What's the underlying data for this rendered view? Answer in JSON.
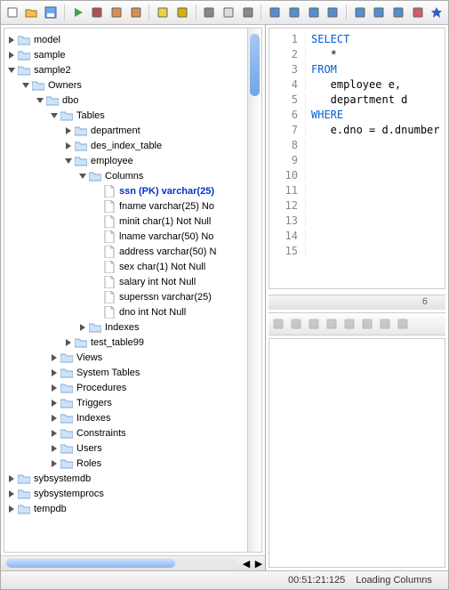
{
  "toolbar": {
    "icons": [
      "new",
      "open",
      "save",
      "sep",
      "run",
      "runbg",
      "copy",
      "paste",
      "sep",
      "db",
      "wand",
      "sep",
      "grid",
      "doc",
      "dbgrid",
      "sep",
      "book",
      "list1",
      "list2",
      "lines",
      "sep",
      "scan",
      "tools",
      "list3",
      "bar",
      "star"
    ]
  },
  "tree": [
    {
      "d": 0,
      "t": "tw-closed",
      "i": "folder",
      "l": "model"
    },
    {
      "d": 0,
      "t": "tw-closed",
      "i": "folder",
      "l": "sample"
    },
    {
      "d": 0,
      "t": "tw-open",
      "i": "folder",
      "l": "sample2"
    },
    {
      "d": 1,
      "t": "tw-open",
      "i": "folder",
      "l": "Owners"
    },
    {
      "d": 2,
      "t": "tw-open",
      "i": "folder",
      "l": "dbo"
    },
    {
      "d": 3,
      "t": "tw-open",
      "i": "folder",
      "l": "Tables"
    },
    {
      "d": 4,
      "t": "tw-closed",
      "i": "folder",
      "l": "department"
    },
    {
      "d": 4,
      "t": "tw-closed",
      "i": "folder",
      "l": "des_index_table"
    },
    {
      "d": 4,
      "t": "tw-open",
      "i": "folder",
      "l": "employee"
    },
    {
      "d": 5,
      "t": "tw-open",
      "i": "folder",
      "l": "Columns"
    },
    {
      "d": 6,
      "t": "none",
      "i": "page",
      "l": "ssn (PK) varchar(25)",
      "pk": true
    },
    {
      "d": 6,
      "t": "none",
      "i": "page",
      "l": "fname varchar(25) No"
    },
    {
      "d": 6,
      "t": "none",
      "i": "page",
      "l": "minit char(1) Not Null"
    },
    {
      "d": 6,
      "t": "none",
      "i": "page",
      "l": "lname varchar(50) No"
    },
    {
      "d": 6,
      "t": "none",
      "i": "page",
      "l": "address varchar(50) N"
    },
    {
      "d": 6,
      "t": "none",
      "i": "page",
      "l": "sex char(1) Not Null"
    },
    {
      "d": 6,
      "t": "none",
      "i": "page",
      "l": "salary int Not Null"
    },
    {
      "d": 6,
      "t": "none",
      "i": "page",
      "l": "superssn varchar(25) "
    },
    {
      "d": 6,
      "t": "none",
      "i": "page",
      "l": "dno int Not Null"
    },
    {
      "d": 5,
      "t": "tw-closed",
      "i": "folder",
      "l": "Indexes"
    },
    {
      "d": 4,
      "t": "tw-closed",
      "i": "folder",
      "l": "test_table99"
    },
    {
      "d": 3,
      "t": "tw-closed",
      "i": "folder",
      "l": "Views"
    },
    {
      "d": 3,
      "t": "tw-closed",
      "i": "folder",
      "l": "System Tables"
    },
    {
      "d": 3,
      "t": "tw-closed",
      "i": "folder",
      "l": "Procedures"
    },
    {
      "d": 3,
      "t": "tw-closed",
      "i": "folder",
      "l": "Triggers"
    },
    {
      "d": 3,
      "t": "tw-closed",
      "i": "folder",
      "l": "Indexes"
    },
    {
      "d": 3,
      "t": "tw-closed",
      "i": "folder",
      "l": "Constraints"
    },
    {
      "d": 3,
      "t": "tw-closed",
      "i": "folder",
      "l": "Users"
    },
    {
      "d": 3,
      "t": "tw-closed",
      "i": "folder",
      "l": "Roles"
    },
    {
      "d": 0,
      "t": "tw-closed",
      "i": "folder",
      "l": "sybsystemdb"
    },
    {
      "d": 0,
      "t": "tw-closed",
      "i": "folder",
      "l": "sybsystemprocs"
    },
    {
      "d": 0,
      "t": "tw-closed",
      "i": "folder",
      "l": "tempdb"
    }
  ],
  "sql": [
    {
      "n": 1,
      "tokens": [
        {
          "t": "SELECT",
          "k": true
        }
      ]
    },
    {
      "n": 2,
      "tokens": [
        {
          "t": "   *",
          "k": false
        }
      ]
    },
    {
      "n": 3,
      "tokens": [
        {
          "t": "FROM",
          "k": true
        }
      ]
    },
    {
      "n": 4,
      "tokens": [
        {
          "t": "   employee e,",
          "k": false
        }
      ]
    },
    {
      "n": 5,
      "tokens": [
        {
          "t": "   department d",
          "k": false
        }
      ]
    },
    {
      "n": 6,
      "tokens": [
        {
          "t": "WHERE",
          "k": true
        }
      ]
    },
    {
      "n": 7,
      "tokens": [
        {
          "t": "   e.dno = d.dnumber",
          "k": false
        }
      ]
    },
    {
      "n": 8,
      "tokens": [],
      "current": true
    },
    {
      "n": 9,
      "tokens": []
    },
    {
      "n": 10,
      "tokens": []
    },
    {
      "n": 11,
      "tokens": []
    },
    {
      "n": 12,
      "tokens": []
    },
    {
      "n": 13,
      "tokens": []
    },
    {
      "n": 14,
      "tokens": []
    },
    {
      "n": 15,
      "tokens": []
    }
  ],
  "editor_scroll_label": "6",
  "mid_toolbar_icons": [
    "undo",
    "redo",
    "comment",
    "adv",
    "indent1",
    "indent2",
    "copy2",
    "paste2"
  ],
  "status": {
    "time": "00:51:21:125",
    "msg": "Loading Columns"
  }
}
